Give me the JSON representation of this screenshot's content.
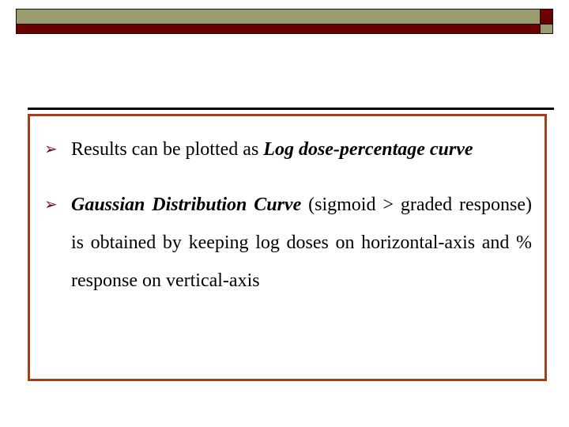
{
  "slide": {
    "title": "",
    "header_bar": {
      "band_top_color": "#9a9b6e",
      "band_bottom_color": "#6b0000",
      "outline_color": "#1a1008",
      "checker_top_color": "#6b0000",
      "checker_bottom_color": "#9a9b6e"
    },
    "rule_color": "#000000",
    "content_box": {
      "border_color": "#ad3c16",
      "background_color": "#ffffff"
    },
    "bullet_marker_glyph": "➢",
    "bullet_marker_color": "#5e1411",
    "bullets": [
      {
        "id": "bullet-log-dose-percentage-curve",
        "segments": [
          {
            "text": "Results can be plotted as ",
            "style": "normal"
          },
          {
            "text": "Log dose-percentage curve",
            "style": "bold-italic"
          }
        ],
        "plain_text": "Results can be plotted as Log dose-percentage curve"
      },
      {
        "id": "bullet-gaussian-distribution-curve",
        "segments": [
          {
            "text": "Gaussian Distribution Curve",
            "style": "bold-italic"
          },
          {
            "text": " (sigmoid > graded response) is obtained by keeping log doses on horizontal-axis and % response on vertical-axis",
            "style": "normal"
          }
        ],
        "plain_text": "Gaussian Distribution Curve (sigmoid > graded response) is obtained by keeping log doses on horizontal-axis and % response on vertical-axis"
      }
    ]
  }
}
